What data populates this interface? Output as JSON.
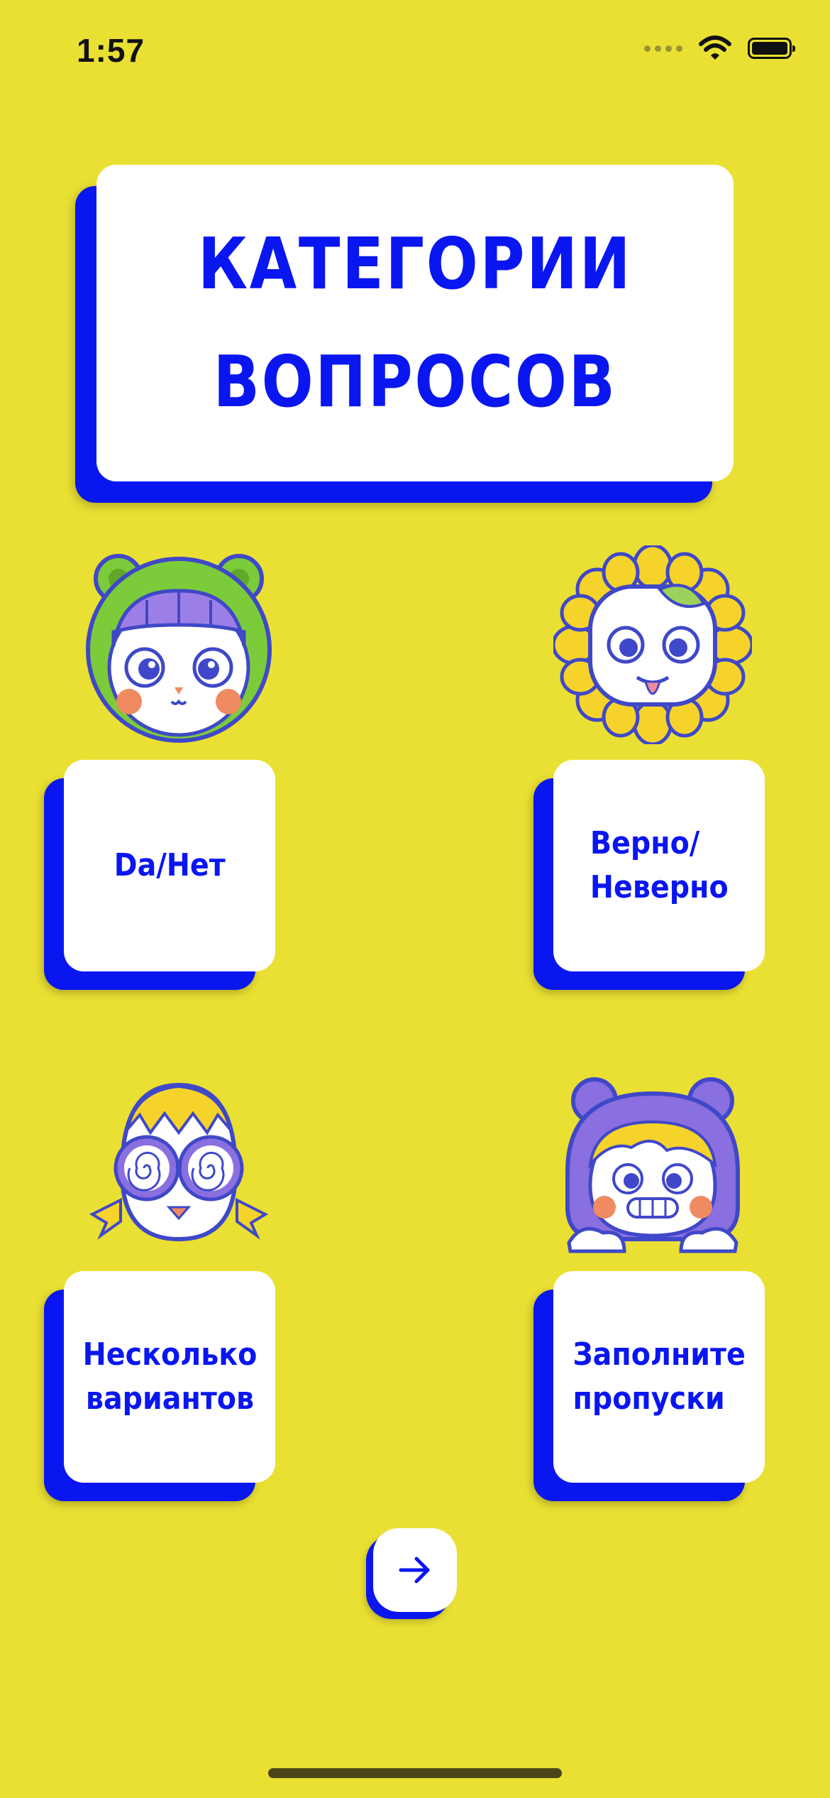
{
  "status_bar": {
    "time": "1:57",
    "icons": [
      "signal-dots-icon",
      "wifi-icon",
      "battery-icon"
    ]
  },
  "title": {
    "line1": "КАТЕГОРИИ",
    "line2": "ВОПРОСОВ"
  },
  "categories": [
    {
      "label": "Da/Нет",
      "mascot": "frog-hood-girl-icon"
    },
    {
      "label": "Верно/\nНеверно",
      "mascot": "sunflower-face-icon"
    },
    {
      "label": "Несколько\nвариантов",
      "mascot": "egg-chick-glasses-icon"
    },
    {
      "label": "Заполните\nпропуски",
      "mascot": "bear-hood-girl-icon"
    }
  ],
  "next_button": {
    "icon": "arrow-right-icon"
  },
  "colors": {
    "background": "#EAE033",
    "accent": "#0A16F0",
    "card": "#FFFFFF",
    "mascot_outline": "#3F48C8",
    "mascot_purple": "#8A6FE0",
    "mascot_green": "#7CCB3A",
    "mascot_yellow": "#F6D32A",
    "blush": "#F08A60"
  }
}
